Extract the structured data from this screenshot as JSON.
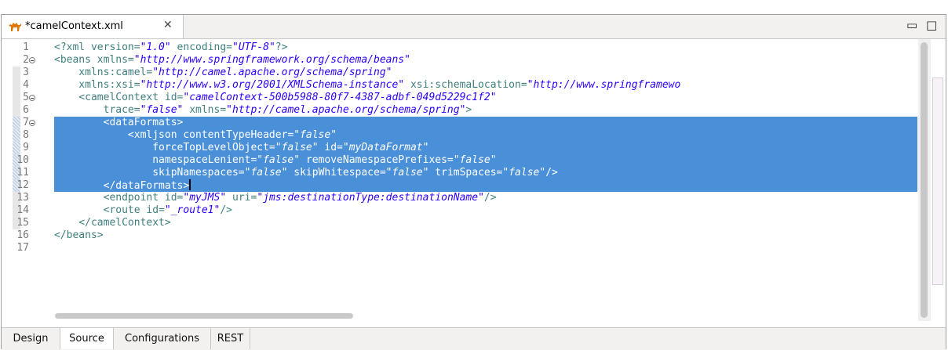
{
  "editor": {
    "tab_title": "*camelContext.xml",
    "close_glyph": "✕",
    "minimize_glyph": "▭",
    "maximize_glyph": "□"
  },
  "lines": [
    {
      "n": "1",
      "fold": false,
      "ruler": "",
      "sel": false
    },
    {
      "n": "2",
      "fold": true,
      "ruler": "",
      "sel": false
    },
    {
      "n": "3",
      "fold": false,
      "ruler": "mark",
      "sel": false
    },
    {
      "n": "4",
      "fold": false,
      "ruler": "mark",
      "sel": false
    },
    {
      "n": "5",
      "fold": true,
      "ruler": "mark",
      "sel": false
    },
    {
      "n": "6",
      "fold": false,
      "ruler": "mark",
      "sel": false
    },
    {
      "n": "7",
      "fold": true,
      "ruler": "stripe",
      "sel": true
    },
    {
      "n": "8",
      "fold": false,
      "ruler": "stripe",
      "sel": true
    },
    {
      "n": "9",
      "fold": false,
      "ruler": "stripe",
      "sel": true
    },
    {
      "n": "10",
      "fold": false,
      "ruler": "stripe",
      "sel": true
    },
    {
      "n": "11",
      "fold": false,
      "ruler": "stripe",
      "sel": true
    },
    {
      "n": "12",
      "fold": false,
      "ruler": "stripe",
      "sel": true
    },
    {
      "n": "13",
      "fold": false,
      "ruler": "mark",
      "sel": false
    },
    {
      "n": "14",
      "fold": false,
      "ruler": "mark",
      "sel": false
    },
    {
      "n": "15",
      "fold": false,
      "ruler": "mark",
      "sel": false
    },
    {
      "n": "16",
      "fold": false,
      "ruler": "",
      "sel": false
    },
    {
      "n": "17",
      "fold": false,
      "ruler": "",
      "sel": false
    }
  ],
  "code": {
    "l1": {
      "a": "<?xml version=",
      "b": "\"1.0\"",
      "c": " encoding=",
      "d": "\"UTF-8\"",
      "e": "?>"
    },
    "l2": {
      "a": "<beans xmlns=",
      "b": "\"http://www.springframework.org/schema/beans\""
    },
    "l3": {
      "a": "    xmlns:camel=",
      "b": "\"http://camel.apache.org/schema/spring\""
    },
    "l4": {
      "a": "    xmlns:xsi=",
      "b": "\"http://www.w3.org/2001/XMLSchema-instance\"",
      "c": " xsi:schemaLocation=",
      "d": "\"http://www.springframewo"
    },
    "l5": {
      "a": "    <camelContext id=",
      "b": "\"camelContext-500b5988-80f7-4387-adbf-049d5229c1f2\""
    },
    "l6": {
      "a": "        trace=",
      "b": "\"false\"",
      "c": " xmlns=",
      "d": "\"http://camel.apache.org/schema/spring\"",
      "e": ">"
    },
    "l7": {
      "a": "        <dataFormats>"
    },
    "l8": {
      "a": "            <xmljson contentTypeHeader=",
      "b": "\"false\""
    },
    "l9": {
      "a": "                forceTopLevelObject=",
      "b": "\"false\"",
      "c": " id=",
      "d": "\"myDataFormat\""
    },
    "l10": {
      "a": "                namespaceLenient=",
      "b": "\"false\"",
      "c": " removeNamespacePrefixes=",
      "d": "\"false\""
    },
    "l11": {
      "a": "                skipNamespaces=",
      "b": "\"false\"",
      "c": " skipWhitespace=",
      "d": "\"false\"",
      "e": " trimSpaces=",
      "f": "\"false\"",
      "g": "/>"
    },
    "l12": {
      "a": "        </dataFormats>"
    },
    "l13": {
      "a": "        <endpoint id=",
      "b": "\"myJMS\"",
      "c": " uri=",
      "d": "\"jms:destinationType:destinationName\"",
      "e": "/>"
    },
    "l14": {
      "a": "        <route id=",
      "b": "\"_route1\"",
      "c": "/>"
    },
    "l15": {
      "a": "    </camelContext>"
    },
    "l16": {
      "a": "</beans>"
    },
    "l17": {
      "a": ""
    }
  },
  "bottom_tabs": [
    "Design",
    "Source",
    "Configurations",
    "REST"
  ],
  "active_bottom_tab": "Source",
  "colors": {
    "selection": "#4a90d9",
    "tag": "#3f7f7f",
    "string": "#2a00ff"
  }
}
